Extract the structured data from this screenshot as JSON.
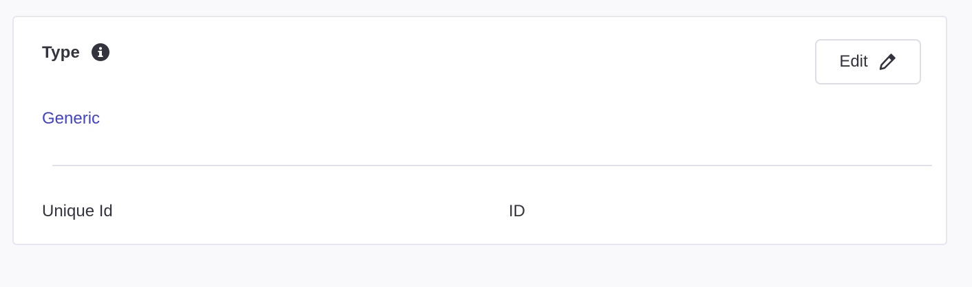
{
  "section": {
    "title": "Type",
    "info_icon": "info-circle-icon",
    "edit_button": {
      "label": "Edit",
      "icon": "pencil-icon"
    },
    "type_value": "Generic"
  },
  "fields": [
    {
      "label": "Unique Id",
      "value": "ID"
    }
  ],
  "colors": {
    "background": "#f9f9fc",
    "card": "#ffffff",
    "border": "#e6e7ef",
    "text": "#34343f",
    "link": "#4141d6",
    "divider": "#e1e1ec"
  }
}
